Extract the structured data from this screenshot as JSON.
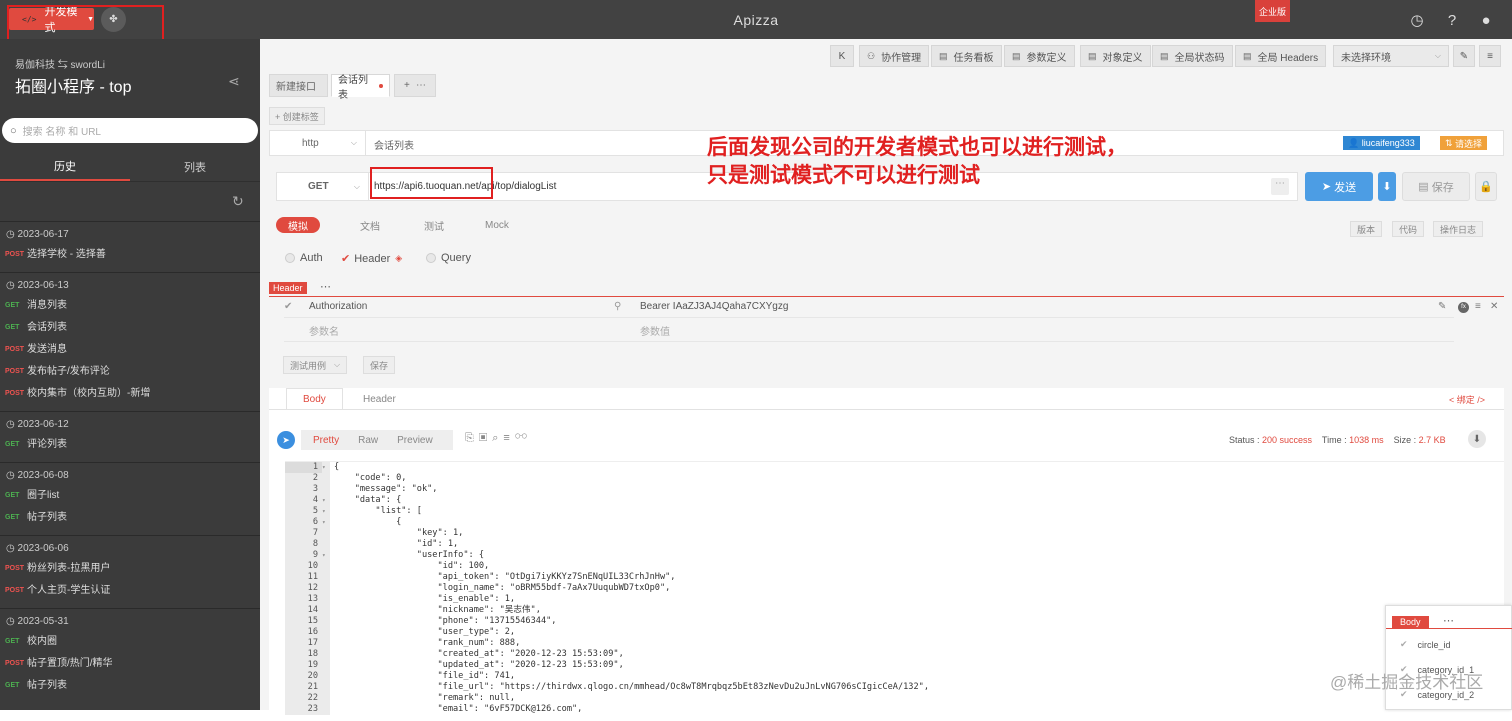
{
  "topbar": {
    "dev_mode": "开发模式",
    "app_name": "Apizza",
    "enterprise": "企业版"
  },
  "sidebar": {
    "org": "易伽科技 ⇆ swordLi",
    "project": "拓圈小程序 - top",
    "search_placeholder": "搜索 名称 和 URL",
    "tabs": [
      "历史",
      "列表"
    ],
    "groups": [
      {
        "date": "2023-06-17",
        "items": [
          {
            "m": "POST",
            "t": "选择学校 - 选择善"
          }
        ]
      },
      {
        "date": "2023-06-13",
        "items": [
          {
            "m": "GET",
            "t": "消息列表"
          },
          {
            "m": "GET",
            "t": "会话列表"
          },
          {
            "m": "POST",
            "t": "发送消息"
          },
          {
            "m": "POST",
            "t": "发布帖子/发布评论"
          },
          {
            "m": "POST",
            "t": "校内集市（校内互助）-新增"
          }
        ]
      },
      {
        "date": "2023-06-12",
        "items": [
          {
            "m": "GET",
            "t": "评论列表"
          }
        ]
      },
      {
        "date": "2023-06-08",
        "items": [
          {
            "m": "GET",
            "t": "圈子list"
          },
          {
            "m": "GET",
            "t": "帖子列表"
          }
        ]
      },
      {
        "date": "2023-06-06",
        "items": [
          {
            "m": "POST",
            "t": "粉丝列表-拉黑用户"
          },
          {
            "m": "POST",
            "t": "个人主页-学生认证"
          }
        ]
      },
      {
        "date": "2023-05-31",
        "items": [
          {
            "m": "GET",
            "t": "校内圈"
          },
          {
            "m": "POST",
            "t": "帖子置顶/热门/精华"
          },
          {
            "m": "GET",
            "t": "帖子列表"
          }
        ]
      }
    ]
  },
  "toolbar": {
    "collab": "协作管理",
    "tasks": "任务看板",
    "params": "参数定义",
    "objects": "对象定义",
    "statuscode": "全局状态码",
    "headers": "全局 Headers",
    "env": "未选择环境"
  },
  "filetabs": [
    "新建接口",
    "会话列表"
  ],
  "create_tag": "+ 创建标签",
  "request": {
    "protocol": "http",
    "name": "会话列表",
    "user": "liucaifeng333",
    "select": "请选择",
    "method": "GET",
    "url": "https://api6.tuoquan.net/api/top/dialogList",
    "send": "发送",
    "save": "保存"
  },
  "mode_tabs": [
    "模拟",
    "文档",
    "测试",
    "Mock"
  ],
  "right_tabs": [
    "版本",
    "代码",
    "操作日志"
  ],
  "auth_options": [
    "Auth",
    "Header",
    "Query"
  ],
  "header_section": {
    "label": "Header",
    "key": "Authorization",
    "value": "Bearer IAaZJ3AJ4Qaha7CXYgzg",
    "key_placeholder": "参数名",
    "value_placeholder": "参数值",
    "test_case": "测试用例",
    "save": "保存"
  },
  "response": {
    "tabs": [
      "Body",
      "Header"
    ],
    "bind": "< 绑定 />",
    "views": [
      "Pretty",
      "Raw",
      "Preview"
    ],
    "status_label": "Status :",
    "status": "200 success",
    "time_label": "Time :",
    "time": "1038 ms",
    "size_label": "Size :",
    "size": "2.7 KB"
  },
  "code_lines": [
    "{",
    "    \"code\": 0,",
    "    \"message\": \"ok\",",
    "    \"data\": {",
    "        \"list\": [",
    "            {",
    "                \"key\": 1,",
    "                \"id\": 1,",
    "                \"userInfo\": {",
    "                    \"id\": 100,",
    "                    \"api_token\": \"OtDgi7iyKKYz7SnENqUIL33CrhJnHw\",",
    "                    \"login_name\": \"oBRM55bdf-7aAx7UuqubWD7txOp0\",",
    "                    \"is_enable\": 1,",
    "                    \"nickname\": \"吴志伟\",",
    "                    \"phone\": \"13715546344\",",
    "                    \"user_type\": 2,",
    "                    \"rank_num\": 888,",
    "                    \"created_at\": \"2020-12-23 15:53:09\",",
    "                    \"updated_at\": \"2020-12-23 15:53:09\",",
    "                    \"file_id\": 741,",
    "                    \"file_url\": \"https://thirdwx.qlogo.cn/mmhead/Oc8wT8Mrqbqz5bEt83zNevDu2uJnLvNG706sCIgicCeA/132\",",
    "                    \"remark\": null,",
    "                    \"email\": \"6vF57DCK@126.com\","
  ],
  "body_panel": {
    "label": "Body",
    "items": [
      "circle_id",
      "category_id_1",
      "category_id_2"
    ]
  },
  "annotation": {
    "line1": "后面发现公司的开发者模式也可以进行测试，",
    "line2": "只是测试模式不可以进行测试"
  },
  "watermark": "@稀土掘金技术社区"
}
